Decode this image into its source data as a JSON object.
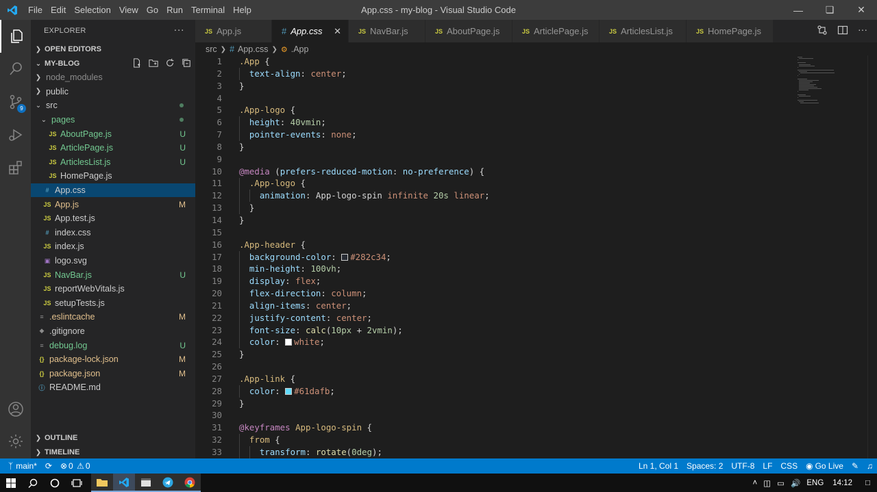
{
  "titlebar": {
    "menu": [
      "File",
      "Edit",
      "Selection",
      "View",
      "Go",
      "Run",
      "Terminal",
      "Help"
    ],
    "title": "App.css - my-blog - Visual Studio Code"
  },
  "activity": {
    "scm_badge": "9"
  },
  "sidebar": {
    "title": "EXPLORER",
    "open_editors": "OPEN EDITORS",
    "project": "MY-BLOG",
    "outline": "OUTLINE",
    "timeline": "TIMELINE",
    "tree": [
      {
        "label": "node_modules",
        "type": "folder",
        "depth": 1,
        "open": false,
        "status": "",
        "color": "gray"
      },
      {
        "label": "public",
        "type": "folder",
        "depth": 1,
        "open": false,
        "status": "",
        "color": "normal"
      },
      {
        "label": "src",
        "type": "folder",
        "depth": 1,
        "open": true,
        "status": "dot",
        "color": "normal"
      },
      {
        "label": "pages",
        "type": "folder",
        "depth": 2,
        "open": true,
        "status": "dot",
        "color": "green"
      },
      {
        "label": "AboutPage.js",
        "type": "js",
        "depth": 3,
        "status": "U",
        "color": "green"
      },
      {
        "label": "ArticlePage.js",
        "type": "js",
        "depth": 3,
        "status": "U",
        "color": "green"
      },
      {
        "label": "ArticlesList.js",
        "type": "js",
        "depth": 3,
        "status": "U",
        "color": "green"
      },
      {
        "label": "HomePage.js",
        "type": "js",
        "depth": 3,
        "status": "",
        "color": "normal"
      },
      {
        "label": "App.css",
        "type": "css",
        "depth": 2,
        "status": "",
        "color": "normal",
        "selected": true
      },
      {
        "label": "App.js",
        "type": "js",
        "depth": 2,
        "status": "M",
        "color": "mod"
      },
      {
        "label": "App.test.js",
        "type": "js",
        "depth": 2,
        "status": "",
        "color": "normal"
      },
      {
        "label": "index.css",
        "type": "css",
        "depth": 2,
        "status": "",
        "color": "normal"
      },
      {
        "label": "index.js",
        "type": "js",
        "depth": 2,
        "status": "",
        "color": "normal"
      },
      {
        "label": "logo.svg",
        "type": "svg",
        "depth": 2,
        "status": "",
        "color": "normal"
      },
      {
        "label": "NavBar.js",
        "type": "js",
        "depth": 2,
        "status": "U",
        "color": "green"
      },
      {
        "label": "reportWebVitals.js",
        "type": "js",
        "depth": 2,
        "status": "",
        "color": "normal"
      },
      {
        "label": "setupTests.js",
        "type": "js",
        "depth": 2,
        "status": "",
        "color": "normal"
      },
      {
        "label": ".eslintcache",
        "type": "file",
        "depth": 1,
        "status": "M",
        "color": "mod"
      },
      {
        "label": ".gitignore",
        "type": "git",
        "depth": 1,
        "status": "",
        "color": "normal"
      },
      {
        "label": "debug.log",
        "type": "file",
        "depth": 1,
        "status": "U",
        "color": "green"
      },
      {
        "label": "package-lock.json",
        "type": "json",
        "depth": 1,
        "status": "M",
        "color": "mod"
      },
      {
        "label": "package.json",
        "type": "json",
        "depth": 1,
        "status": "M",
        "color": "mod"
      },
      {
        "label": "README.md",
        "type": "md",
        "depth": 1,
        "status": "",
        "color": "normal"
      }
    ]
  },
  "tabs": [
    {
      "label": "App.js",
      "type": "js"
    },
    {
      "label": "App.css",
      "type": "css",
      "active": true
    },
    {
      "label": "NavBar.js",
      "type": "js"
    },
    {
      "label": "AboutPage.js",
      "type": "js"
    },
    {
      "label": "ArticlePage.js",
      "type": "js"
    },
    {
      "label": "ArticlesList.js",
      "type": "js"
    },
    {
      "label": "HomePage.js",
      "type": "js"
    }
  ],
  "breadcrumb": [
    "src",
    "App.css",
    ".App"
  ],
  "code_lines": [
    ".App {",
    "  text-align: center;",
    "}",
    "",
    ".App-logo {",
    "  height: 40vmin;",
    "  pointer-events: none;",
    "}",
    "",
    "@media (prefers-reduced-motion: no-preference) {",
    "  .App-logo {",
    "    animation: App-logo-spin infinite 20s linear;",
    "  }",
    "}",
    "",
    ".App-header {",
    "  background-color: #282c34;",
    "  min-height: 100vh;",
    "  display: flex;",
    "  flex-direction: column;",
    "  align-items: center;",
    "  justify-content: center;",
    "  font-size: calc(10px + 2vmin);",
    "  color: white;",
    "}",
    "",
    ".App-link {",
    "  color: #61dafb;",
    "}",
    "",
    "@keyframes App-logo-spin {",
    "  from {",
    "    transform: rotate(0deg);"
  ],
  "statusbar": {
    "branch": "main*",
    "problems": "0",
    "warnings": "0",
    "position": "Ln 1, Col 1",
    "spaces": "Spaces: 2",
    "encoding": "UTF-8",
    "eol": "LF",
    "language": "CSS",
    "golive": "Go Live"
  },
  "taskbar": {
    "lang": "ENG",
    "time": "14:12"
  }
}
